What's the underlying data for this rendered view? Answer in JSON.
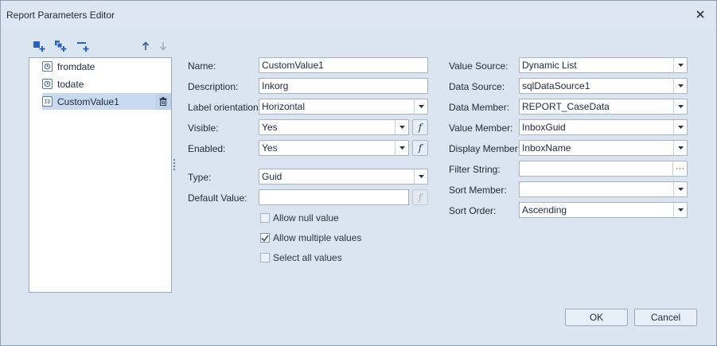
{
  "window": {
    "title": "Report Parameters Editor"
  },
  "toolbar": {
    "icons": [
      "add-parameter-icon",
      "add-cascading-parameter-icon",
      "add-range-parameter-icon",
      "move-up-icon",
      "move-down-icon"
    ]
  },
  "parameters": [
    {
      "label": "fromdate",
      "icon": "date-param-icon"
    },
    {
      "label": "todate",
      "icon": "date-param-icon"
    },
    {
      "label": "CustomValue1",
      "icon": "id-param-icon",
      "icon_text": "ID"
    }
  ],
  "left_form": {
    "name_label": "Name:",
    "name_value": "CustomValue1",
    "description_label": "Description:",
    "description_value": "Inkorg",
    "label_orientation_label": "Label orientation:",
    "label_orientation_value": "Horizontal",
    "visible_label": "Visible:",
    "visible_value": "Yes",
    "enabled_label": "Enabled:",
    "enabled_value": "Yes",
    "type_label": "Type:",
    "type_value": "Guid",
    "default_value_label": "Default Value:",
    "default_value_value": "",
    "fx_symbol": "f"
  },
  "checkboxes": {
    "allow_null": {
      "label": "Allow null value",
      "checked": false
    },
    "allow_multiple": {
      "label": "Allow multiple values",
      "checked": true
    },
    "select_all": {
      "label": "Select all values",
      "checked": false
    }
  },
  "right_form": {
    "value_source_label": "Value Source:",
    "value_source_value": "Dynamic List",
    "data_source_label": "Data Source:",
    "data_source_value": "sqlDataSource1",
    "data_member_label": "Data Member:",
    "data_member_value": "REPORT_CaseData",
    "value_member_label": "Value Member:",
    "value_member_value": "InboxGuid",
    "display_member_label": "Display Member:",
    "display_member_value": "InboxName",
    "filter_string_label": "Filter String:",
    "filter_string_value": "",
    "filter_ellipsis": "···",
    "sort_member_label": "Sort Member:",
    "sort_member_value": "",
    "sort_order_label": "Sort Order:",
    "sort_order_value": "Ascending"
  },
  "buttons": {
    "ok": "OK",
    "cancel": "Cancel"
  },
  "colors": {
    "accent": "#2b62b7",
    "window_bg": "#dbe5f1",
    "selection": "#c9d9ef"
  }
}
